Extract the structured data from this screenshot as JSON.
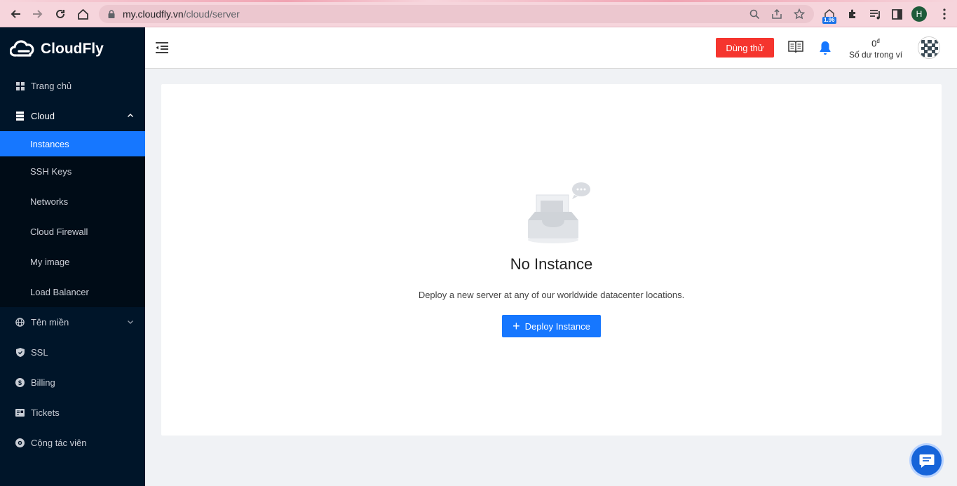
{
  "browser": {
    "url_host": "my.cloudfly.vn",
    "url_path": "/cloud/server",
    "extension_badge": "1.96",
    "profile_initial": "H"
  },
  "sidebar": {
    "brand": "CloudFly",
    "items": [
      {
        "label": "Trang chủ",
        "icon": "dashboard-icon"
      },
      {
        "label": "Cloud",
        "icon": "server-icon"
      },
      {
        "label": "Tên miền",
        "icon": "globe-icon"
      },
      {
        "label": "SSL",
        "icon": "shield-icon"
      },
      {
        "label": "Billing",
        "icon": "dollar-icon"
      },
      {
        "label": "Tickets",
        "icon": "ticket-icon"
      },
      {
        "label": "Cộng tác viên",
        "icon": "partner-icon"
      }
    ],
    "cloud_submenu": [
      {
        "label": "Instances",
        "active": true
      },
      {
        "label": "SSH Keys"
      },
      {
        "label": "Networks"
      },
      {
        "label": "Cloud Firewall"
      },
      {
        "label": "My image"
      },
      {
        "label": "Load Balancer"
      }
    ]
  },
  "header": {
    "trial_label": "Dùng thử",
    "wallet_amount": "0",
    "wallet_currency": "đ",
    "wallet_label": "Số dư trong ví"
  },
  "empty_state": {
    "title": "No Instance",
    "description": "Deploy a new server at any of our worldwide datacenter locations.",
    "button_label": "Deploy Instance"
  },
  "colors": {
    "sidebar_bg": "#001529",
    "active_item": "#1677ff",
    "trial_button": "#f5352e",
    "primary": "#1677ff"
  }
}
